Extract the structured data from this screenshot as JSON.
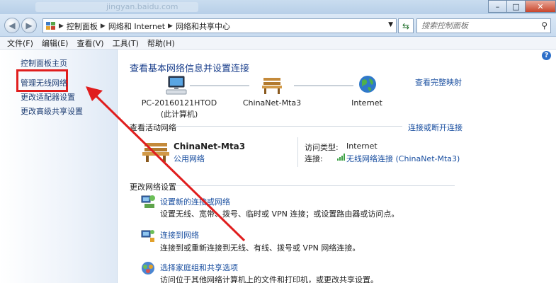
{
  "title_bar": {
    "ghost_url": "jingyan.baidu.com",
    "buttons": {
      "min": "–",
      "max": "□",
      "close": "✕"
    }
  },
  "address": {
    "crumbs": [
      "控制面板",
      "网络和 Internet",
      "网络和共享中心"
    ],
    "search_placeholder": "搜索控制面板"
  },
  "menu": [
    "文件(F)",
    "编辑(E)",
    "查看(V)",
    "工具(T)",
    "帮助(H)"
  ],
  "sidebar": {
    "items": [
      {
        "label": "控制面板主页"
      },
      {
        "label": "管理无线网络"
      },
      {
        "label": "更改适配器设置"
      },
      {
        "label": "更改高级共享设置"
      }
    ]
  },
  "main": {
    "title": "查看基本网络信息并设置连接",
    "full_map_link": "查看完整映射",
    "nodes": [
      {
        "label": "PC-20160121HTOD",
        "sublabel": "(此计算机)",
        "icon": "computer-icon"
      },
      {
        "label": "ChinaNet-Mta3",
        "icon": "bench-icon"
      },
      {
        "label": "Internet",
        "icon": "globe-icon"
      }
    ],
    "active_section": {
      "heading": "查看活动网络",
      "connect_link": "连接或断开连接",
      "network_name": "ChinaNet-Mta3",
      "network_type": "公用网络",
      "access_type_label": "访问类型:",
      "access_type_value": "Internet",
      "connection_label": "连接:",
      "connection_value": "无线网络连接 (ChinaNet-Mta3)"
    },
    "change_section": {
      "heading": "更改网络设置",
      "tasks": [
        {
          "link": "设置新的连接或网络",
          "desc": "设置无线、宽带、拨号、临时或 VPN 连接；或设置路由器或访问点。",
          "icon": "network-setup-icon"
        },
        {
          "link": "连接到网络",
          "desc": "连接到或重新连接到无线、有线、拨号或 VPN 网络连接。",
          "icon": "connect-network-icon"
        },
        {
          "link": "选择家庭组和共享选项",
          "desc": "访问位于其他网络计算机上的文件和打印机，或更改共享设置。",
          "icon": "homegroup-icon"
        }
      ]
    }
  },
  "colors": {
    "link": "#1a4fa0",
    "annotation_red": "#e01e1e"
  }
}
